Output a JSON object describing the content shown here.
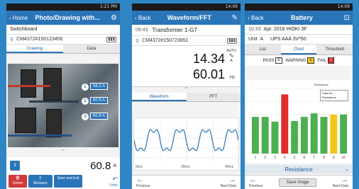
{
  "status": {
    "time1": "1:21 PM",
    "time2": "14:09",
    "time3": "14:09"
  },
  "screen1": {
    "back_label": "Home",
    "title": "Photo/Drawing with...",
    "section": "Switchboard",
    "device": "CM4372#150123456",
    "tabs": [
      "Drawing",
      "Data"
    ],
    "tags": [
      {
        "num": "1",
        "text": "58.2 A"
      },
      {
        "num": "2",
        "text": "60.5 A"
      },
      {
        "num": "3",
        "text": "60.8 A"
      }
    ],
    "chip": "3",
    "value": "60.8",
    "unit": "A",
    "actions": [
      "Delete",
      "Measure",
      "Save and Exit"
    ],
    "undo": "Undo"
  },
  "screen2": {
    "back_label": "Back",
    "title": "Waveform/FFT",
    "time": "09:43",
    "location": "Transformer 1-G7",
    "device": "CM4372#150723851",
    "value1": "14.34",
    "unit1_top": "AUTO",
    "unit1_bot": "A",
    "value2": "60.01",
    "unit2": "Hz",
    "tabs": [
      "Waveform",
      "FFT"
    ],
    "axis_labels": [
      "0ms",
      "20ms",
      "40ms"
    ],
    "legend": "A",
    "nav_prev": "Previous",
    "nav_next": "Next Data"
  },
  "screen3": {
    "back_label": "Back",
    "title": "Battery",
    "datetime": "10:33",
    "location": "Apr. 2016 HIOKI 3F",
    "unit_label": "Unit",
    "unit_value": "A",
    "unit_desc": "UPS AAA 3V*50",
    "tabs": [
      "List",
      "Chart",
      "Threshold"
    ],
    "pass_label": "PASS",
    "pass_count": "8",
    "warn_label": "WARNING",
    "warn_count": "1",
    "fail_label": "FAIL",
    "fail_count": "1",
    "dropdown_items": [
      "Data No.",
      "Resistance"
    ],
    "chart_heading": "Resistance",
    "resistance_label": "Resistance",
    "save_label": "Save image",
    "nav_prev": "Previous",
    "nav_next": "Next Data",
    "colors": {
      "pass": "#4caf50",
      "warning": "#f3c71e",
      "fail": "#e02b2b"
    }
  },
  "chart_data": {
    "type": "bar",
    "categories": [
      "1",
      "2",
      "3",
      "4",
      "5",
      "6",
      "7",
      "8",
      "9",
      "10"
    ],
    "values": [
      0.62,
      0.62,
      0.54,
      1.0,
      0.55,
      0.62,
      0.68,
      0.62,
      0.66,
      0.66
    ],
    "status": [
      "pass",
      "pass",
      "pass",
      "fail",
      "pass",
      "pass",
      "pass",
      "pass",
      "warning",
      "pass"
    ],
    "ylim": [
      0,
      1.1
    ],
    "title": "Resistance",
    "xlabel": "",
    "ylabel": "",
    "grid": true
  }
}
